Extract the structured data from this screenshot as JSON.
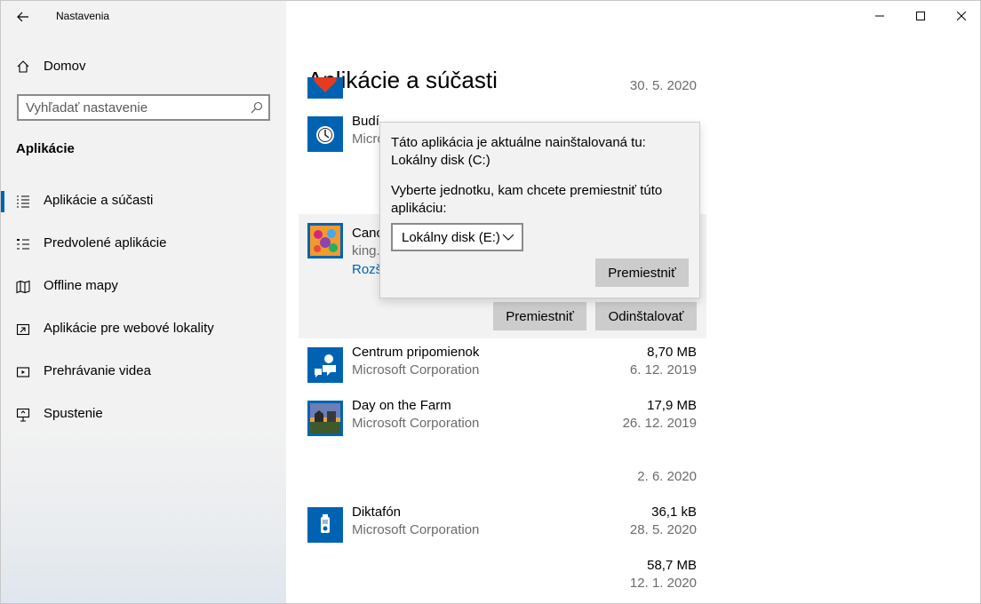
{
  "window": {
    "title": "Nastavenia"
  },
  "sidebar": {
    "home_label": "Domov",
    "search_placeholder": "Vyhľadať nastavenie",
    "section_title": "Aplikácie",
    "items": [
      {
        "label": "Aplikácie a súčasti",
        "icon": "apps-list-icon",
        "active": true
      },
      {
        "label": "Predvolené aplikácie",
        "icon": "default-apps-icon"
      },
      {
        "label": "Offline mapy",
        "icon": "map-icon"
      },
      {
        "label": "Aplikácie pre webové lokality",
        "icon": "web-apps-icon"
      },
      {
        "label": "Prehrávanie videa",
        "icon": "video-icon"
      },
      {
        "label": "Spustenie",
        "icon": "startup-icon"
      }
    ]
  },
  "main": {
    "title": "Aplikácie a súčasti",
    "apps": [
      {
        "name": "",
        "publisher": "",
        "size": "",
        "date": "30. 5. 2020",
        "icon": "red-heart-icon"
      },
      {
        "name": "Budí",
        "publisher": "Micro",
        "size": "",
        "date": "",
        "icon": "alarm-clock-icon"
      },
      {
        "name": "Canc",
        "publisher": "king.",
        "size": "",
        "date": "",
        "icon": "candy-crush-icon",
        "advanced": "Rozš"
      },
      {
        "name": "Centrum pripomienok",
        "publisher": "Microsoft Corporation",
        "size": "8,70 MB",
        "date": "6. 12. 2019",
        "icon": "feedback-hub-icon"
      },
      {
        "name": "Day on the Farm",
        "publisher": "Microsoft Corporation",
        "size": "17,9 MB",
        "date": "26. 12. 2019",
        "icon": "farm-game-icon"
      },
      {
        "name": "",
        "publisher": "",
        "size": "",
        "date": "2. 6. 2020",
        "icon": ""
      },
      {
        "name": "Diktafón",
        "publisher": "Microsoft Corporation",
        "size": "36,1 kB",
        "date": "28. 5. 2020",
        "icon": "voice-recorder-icon"
      },
      {
        "name": "",
        "publisher": "",
        "size": "58,7 MB",
        "date": "12. 1. 2020",
        "icon": ""
      }
    ],
    "buttons": {
      "move": "Premiestniť",
      "uninstall": "Odinštalovať"
    }
  },
  "popup": {
    "installed_text": "Táto aplikácia je aktuálne nainštalovaná tu: Lokálny disk (C:)",
    "choose_text": "Vyberte jednotku, kam chcete premiestniť túto aplikáciu:",
    "selected_drive": "Lokálny disk (E:)",
    "move_button": "Premiestniť"
  },
  "colors": {
    "accent": "#0063b1",
    "icon_tile": "#0063b1",
    "button_bg": "#cccccc"
  }
}
